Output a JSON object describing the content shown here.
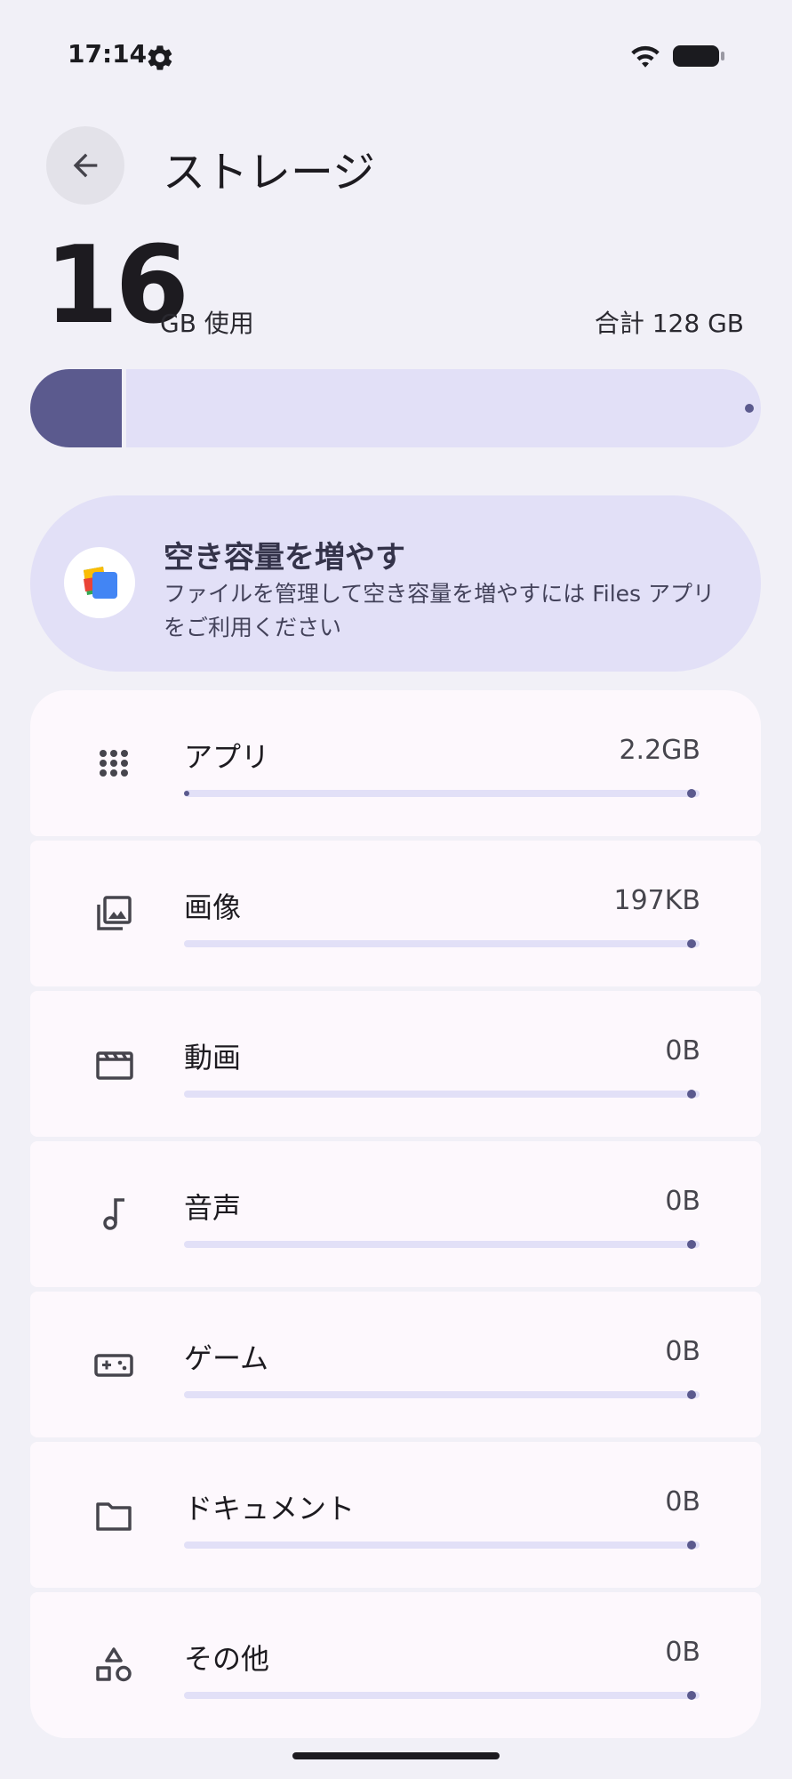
{
  "status_bar": {
    "time": "17:14"
  },
  "header": {
    "title": "ストレージ"
  },
  "summary": {
    "used_value": "16",
    "used_unit_label": "GB 使用",
    "total_label": "合計 128 GB",
    "used_fraction": 0.125
  },
  "promo": {
    "title": "空き容量を増やす",
    "description": "ファイルを管理して空き容量を増やすには Files アプリをご利用ください"
  },
  "categories": [
    {
      "label": "アプリ",
      "value": "2.2GB",
      "icon": "apps-grid-icon"
    },
    {
      "label": "画像",
      "value": "197KB",
      "icon": "image-icon"
    },
    {
      "label": "動画",
      "value": "0B",
      "icon": "clapperboard-icon"
    },
    {
      "label": "音声",
      "value": "0B",
      "icon": "music-note-icon"
    },
    {
      "label": "ゲーム",
      "value": "0B",
      "icon": "gamepad-icon"
    },
    {
      "label": "ドキュメント",
      "value": "0B",
      "icon": "folder-icon"
    },
    {
      "label": "その他",
      "value": "0B",
      "icon": "shapes-icon"
    }
  ],
  "colors": {
    "background": "#f1f0f7",
    "accent": "#5b5a8e",
    "track": "#e2e0f7",
    "card": "#fdf8fd"
  }
}
